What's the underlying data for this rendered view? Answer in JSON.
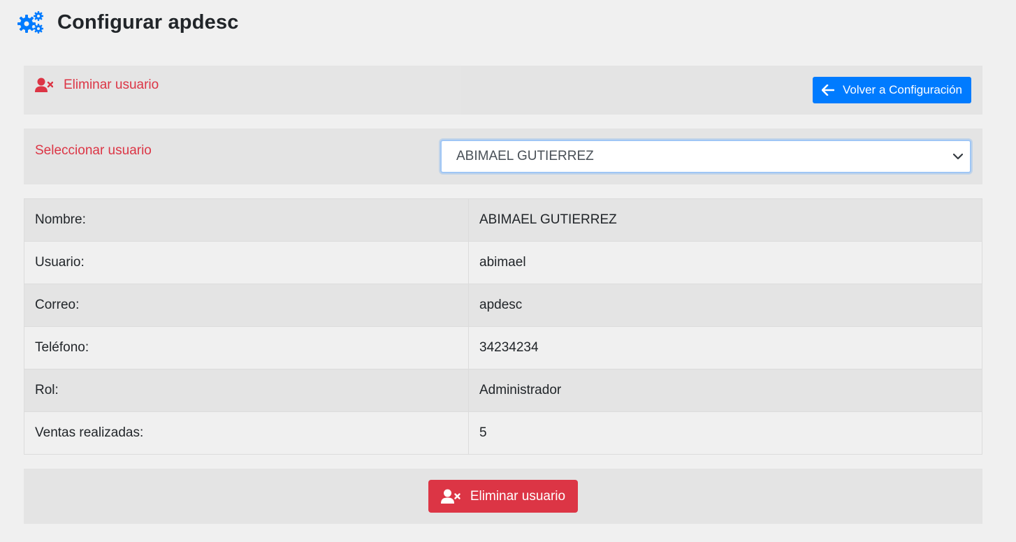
{
  "header": {
    "title": "Configurar apdesc",
    "icon": "gears-icon"
  },
  "colors": {
    "danger": "#dc3545",
    "primary": "#007bff",
    "panel": "#e4e4e4",
    "background": "#f0f0f0"
  },
  "panel": {
    "title": "Eliminar usuario",
    "title_icon": "user-times-icon",
    "back_button": "Volver a Configuración",
    "back_icon": "arrow-left-icon"
  },
  "selector": {
    "label": "Seleccionar usuario",
    "selected": "ABIMAEL GUTIERREZ"
  },
  "details": [
    {
      "label": "Nombre:",
      "value": "ABIMAEL GUTIERREZ"
    },
    {
      "label": "Usuario:",
      "value": "abimael"
    },
    {
      "label": "Correo:",
      "value": "apdesc"
    },
    {
      "label": "Teléfono:",
      "value": "34234234"
    },
    {
      "label": "Rol:",
      "value": "Administrador"
    },
    {
      "label": "Ventas realizadas:",
      "value": "5"
    }
  ],
  "footer": {
    "delete_button": "Eliminar usuario",
    "delete_icon": "user-times-icon"
  }
}
